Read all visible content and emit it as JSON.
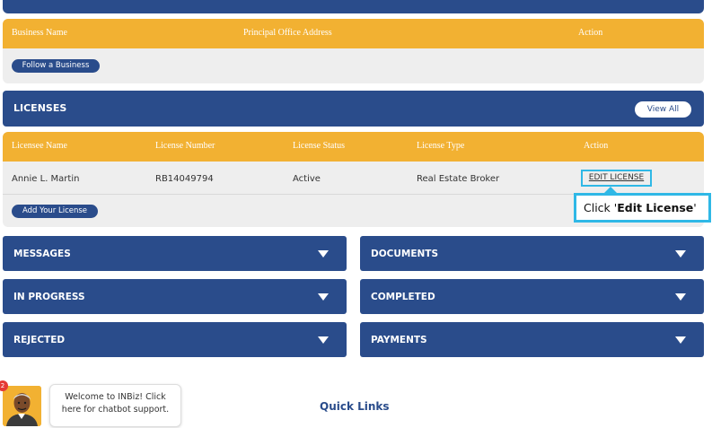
{
  "business_table": {
    "headers": [
      "Business Name",
      "Principal Office Address",
      "Action"
    ],
    "follow_button": "Follow a Business"
  },
  "licenses_section": {
    "title": "LICENSES",
    "view_all": "View All"
  },
  "license_table": {
    "headers": [
      "Licensee Name",
      "License Number",
      "License Status",
      "License Type",
      "Action"
    ],
    "rows": [
      {
        "name": "Annie L. Martin",
        "number": "RB14049794",
        "status": "Active",
        "type": "Real Estate Broker",
        "action": "EDIT LICENSE"
      }
    ],
    "add_button": "Add Your License"
  },
  "callout": {
    "prefix": "Click '",
    "bold": "Edit License",
    "suffix": "'"
  },
  "panels": {
    "messages": "MESSAGES",
    "documents": "DOCUMENTS",
    "in_progress": "IN PROGRESS",
    "completed": "COMPLETED",
    "rejected": "REJECTED",
    "payments": "PAYMENTS"
  },
  "chatbot": {
    "badge": "2",
    "message": "Welcome to INBiz! Click here for chatbot support."
  },
  "footer": {
    "quick_links": "Quick Links"
  },
  "colors": {
    "primary_blue": "#2a4c8b",
    "header_gold": "#f2b132",
    "highlight_cyan": "#2fb8e6"
  }
}
